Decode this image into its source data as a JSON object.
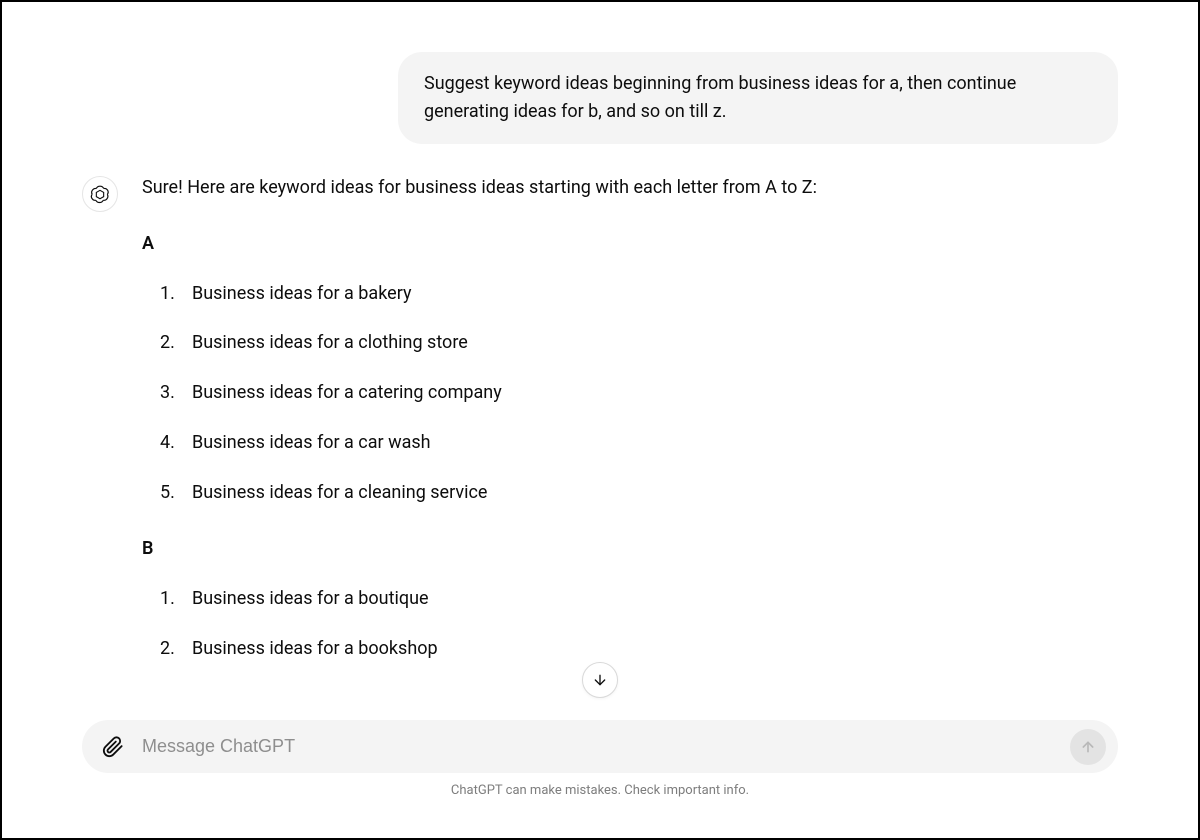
{
  "user_message": "Suggest keyword ideas beginning from business ideas for a, then continue generating ideas for b, and so on till z.",
  "assistant": {
    "intro": "Sure! Here are keyword ideas for business ideas starting with each letter from A to Z:",
    "sections": [
      {
        "heading": "A",
        "items": [
          "Business ideas for a bakery",
          "Business ideas for a clothing store",
          "Business ideas for a catering company",
          "Business ideas for a car wash",
          "Business ideas for a cleaning service"
        ]
      },
      {
        "heading": "B",
        "items": [
          "Business ideas for a boutique",
          "Business ideas for a bookshop"
        ]
      }
    ]
  },
  "input": {
    "placeholder": "Message ChatGPT"
  },
  "disclaimer": "ChatGPT can make mistakes. Check important info.",
  "icons": {
    "assistant": "openai-logo-icon",
    "attach": "paperclip-icon",
    "send": "arrow-up-icon",
    "scroll_down": "arrow-down-icon"
  }
}
